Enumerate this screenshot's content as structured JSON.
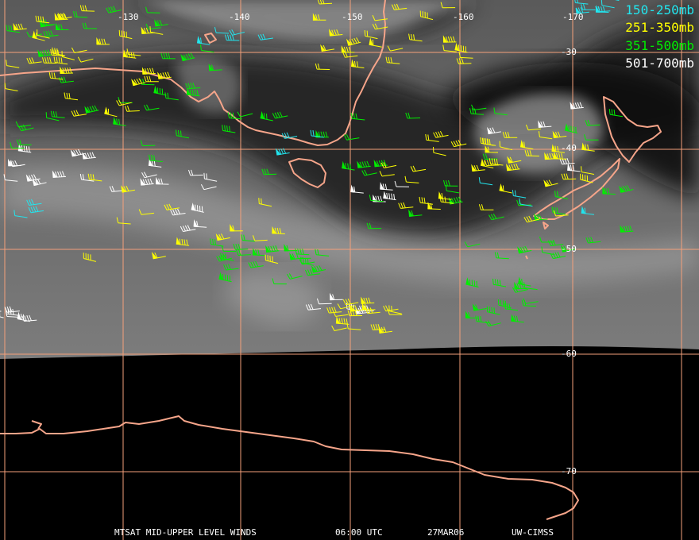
{
  "legend": [
    {
      "label": "150-250mb",
      "color": "#22e5ee"
    },
    {
      "label": "251-350mb",
      "color": "#ffff00"
    },
    {
      "label": "351-500mb",
      "color": "#00ee00"
    },
    {
      "label": "501-700mb",
      "color": "#ffffff"
    }
  ],
  "grid": {
    "longitudes": [
      "-130",
      "-140",
      "-150",
      "-160",
      "-170"
    ],
    "latitudes": [
      "-30",
      "-40",
      "-50",
      "-60",
      "-70"
    ],
    "line_color": "#f4a07a"
  },
  "coast_color": "#f6a58a",
  "footer": {
    "product": "MTSAT MID-UPPER LEVEL WINDS",
    "time": "06:00 UTC",
    "date": "27MAR06",
    "source": "UW-CIMSS"
  }
}
